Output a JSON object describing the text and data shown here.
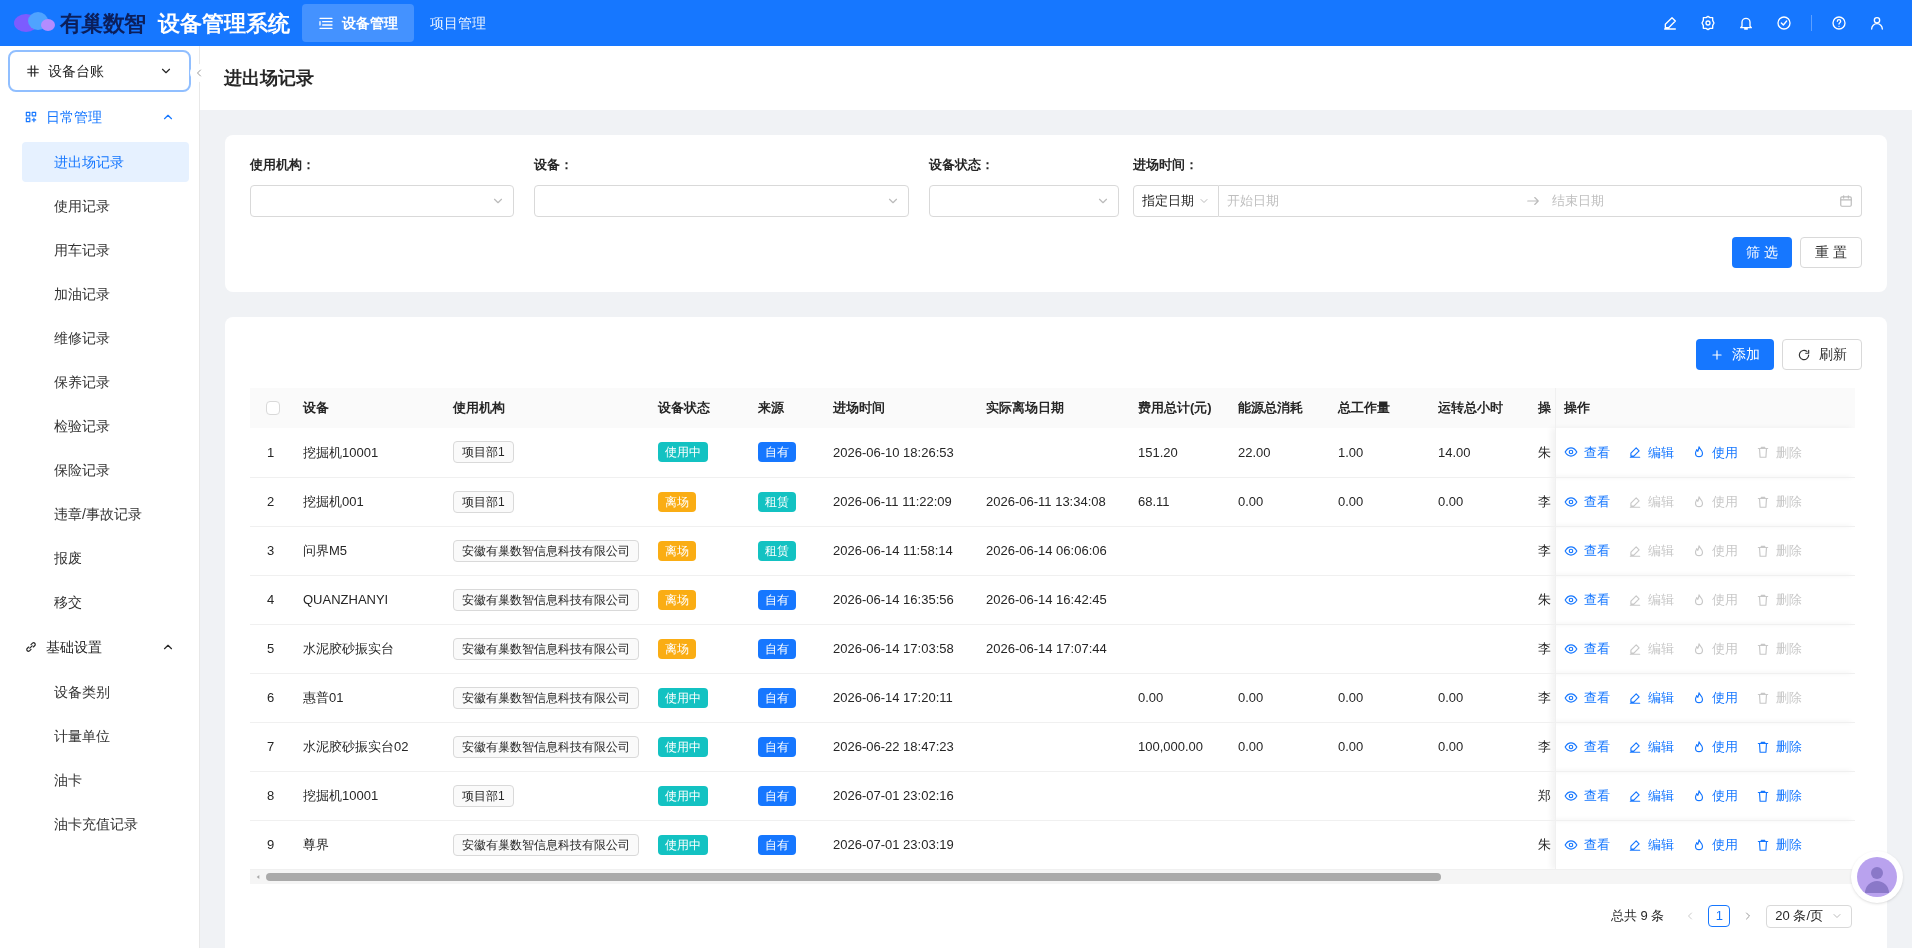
{
  "header": {
    "logo_text": "有巢数智",
    "app_title": "设备管理系统",
    "nav_tabs": [
      {
        "label": "设备管理",
        "selected": true
      },
      {
        "label": "项目管理",
        "selected": false
      }
    ]
  },
  "sidebar": {
    "items": [
      {
        "label": "设备台账",
        "kind": "ledger",
        "expanded": false,
        "focused": true
      },
      {
        "label": "日常管理",
        "kind": "daily",
        "expanded": true,
        "focused": false,
        "children": [
          {
            "label": "进出场记录",
            "selected": true
          },
          {
            "label": "使用记录",
            "selected": false
          },
          {
            "label": "用车记录",
            "selected": false
          },
          {
            "label": "加油记录",
            "selected": false
          },
          {
            "label": "维修记录",
            "selected": false
          },
          {
            "label": "保养记录",
            "selected": false
          },
          {
            "label": "检验记录",
            "selected": false
          },
          {
            "label": "保险记录",
            "selected": false
          },
          {
            "label": "违章/事故记录",
            "selected": false
          },
          {
            "label": "报废",
            "selected": false
          },
          {
            "label": "移交",
            "selected": false
          }
        ]
      },
      {
        "label": "基础设置",
        "kind": "settings",
        "expanded": true,
        "focused": false,
        "children": [
          {
            "label": "设备类别",
            "selected": false
          },
          {
            "label": "计量单位",
            "selected": false
          },
          {
            "label": "油卡",
            "selected": false
          },
          {
            "label": "油卡充值记录",
            "selected": false
          }
        ]
      }
    ]
  },
  "page_title": "进出场记录",
  "filters": {
    "fields": [
      {
        "label": "使用机构：",
        "kind": "select"
      },
      {
        "label": "设备：",
        "kind": "select"
      },
      {
        "label": "设备状态：",
        "kind": "select"
      },
      {
        "label": "进场时间：",
        "kind": "daterange",
        "mode": "指定日期",
        "start_placeholder": "开始日期",
        "end_placeholder": "结束日期"
      }
    ],
    "buttons": [
      {
        "label": "筛 选",
        "primary": true
      },
      {
        "label": "重 置",
        "primary": false
      }
    ]
  },
  "toolbar": [
    {
      "label": "添加",
      "kind": "add",
      "primary": true
    },
    {
      "label": "刷新",
      "kind": "refresh",
      "primary": false
    }
  ],
  "table": {
    "select_all_checked": false,
    "columns": [
      "设备",
      "使用机构",
      "设备状态",
      "来源",
      "进场时间",
      "实际离场日期",
      "费用总计(元)",
      "能源总消耗",
      "总工作量",
      "运转总小时",
      "操",
      "操作"
    ],
    "rows": [
      {
        "index": "1",
        "device": "挖掘机10001",
        "org": "项目部1",
        "status": {
          "text": "使用中",
          "color": "#13c2c2"
        },
        "source": {
          "text": "自有",
          "color": "#1677ff"
        },
        "entry_time": "2026-06-10 18:26:53",
        "exit_time": "",
        "cost": "151.20",
        "energy": "22.00",
        "workload": "1.00",
        "hours": "14.00",
        "operator": "朱",
        "actions": [
          {
            "label": "查看",
            "kind": "view",
            "enabled": true
          },
          {
            "label": "编辑",
            "kind": "edit",
            "enabled": true
          },
          {
            "label": "使用",
            "kind": "use",
            "enabled": true
          },
          {
            "label": "删除",
            "kind": "delete",
            "enabled": false
          }
        ]
      },
      {
        "index": "2",
        "device": "挖掘机001",
        "org": "项目部1",
        "status": {
          "text": "离场",
          "color": "#faad14"
        },
        "source": {
          "text": "租赁",
          "color": "#13c2c2"
        },
        "entry_time": "2026-06-11 11:22:09",
        "exit_time": "2026-06-11 13:34:08",
        "cost": "68.11",
        "energy": "0.00",
        "workload": "0.00",
        "hours": "0.00",
        "operator": "李",
        "actions": [
          {
            "label": "查看",
            "kind": "view",
            "enabled": true
          },
          {
            "label": "编辑",
            "kind": "edit",
            "enabled": false
          },
          {
            "label": "使用",
            "kind": "use",
            "enabled": false
          },
          {
            "label": "删除",
            "kind": "delete",
            "enabled": false
          }
        ]
      },
      {
        "index": "3",
        "device": "问界M5",
        "org": "安徽有巢数智信息科技有限公司",
        "status": {
          "text": "离场",
          "color": "#faad14"
        },
        "source": {
          "text": "租赁",
          "color": "#13c2c2"
        },
        "entry_time": "2026-06-14 11:58:14",
        "exit_time": "2026-06-14 06:06:06",
        "cost": "",
        "energy": "",
        "workload": "",
        "hours": "",
        "operator": "李",
        "actions": [
          {
            "label": "查看",
            "kind": "view",
            "enabled": true
          },
          {
            "label": "编辑",
            "kind": "edit",
            "enabled": false
          },
          {
            "label": "使用",
            "kind": "use",
            "enabled": false
          },
          {
            "label": "删除",
            "kind": "delete",
            "enabled": false
          }
        ]
      },
      {
        "index": "4",
        "device": "QUANZHANYI",
        "org": "安徽有巢数智信息科技有限公司",
        "status": {
          "text": "离场",
          "color": "#faad14"
        },
        "source": {
          "text": "自有",
          "color": "#1677ff"
        },
        "entry_time": "2026-06-14 16:35:56",
        "exit_time": "2026-06-14 16:42:45",
        "cost": "",
        "energy": "",
        "workload": "",
        "hours": "",
        "operator": "朱",
        "actions": [
          {
            "label": "查看",
            "kind": "view",
            "enabled": true
          },
          {
            "label": "编辑",
            "kind": "edit",
            "enabled": false
          },
          {
            "label": "使用",
            "kind": "use",
            "enabled": false
          },
          {
            "label": "删除",
            "kind": "delete",
            "enabled": false
          }
        ]
      },
      {
        "index": "5",
        "device": "水泥胶砂振实台",
        "org": "安徽有巢数智信息科技有限公司",
        "status": {
          "text": "离场",
          "color": "#faad14"
        },
        "source": {
          "text": "自有",
          "color": "#1677ff"
        },
        "entry_time": "2026-06-14 17:03:58",
        "exit_time": "2026-06-14 17:07:44",
        "cost": "",
        "energy": "",
        "workload": "",
        "hours": "",
        "operator": "李",
        "actions": [
          {
            "label": "查看",
            "kind": "view",
            "enabled": true
          },
          {
            "label": "编辑",
            "kind": "edit",
            "enabled": false
          },
          {
            "label": "使用",
            "kind": "use",
            "enabled": false
          },
          {
            "label": "删除",
            "kind": "delete",
            "enabled": false
          }
        ]
      },
      {
        "index": "6",
        "device": "惠普01",
        "org": "安徽有巢数智信息科技有限公司",
        "status": {
          "text": "使用中",
          "color": "#13c2c2"
        },
        "source": {
          "text": "自有",
          "color": "#1677ff"
        },
        "entry_time": "2026-06-14 17:20:11",
        "exit_time": "",
        "cost": "0.00",
        "energy": "0.00",
        "workload": "0.00",
        "hours": "0.00",
        "operator": "李",
        "actions": [
          {
            "label": "查看",
            "kind": "view",
            "enabled": true
          },
          {
            "label": "编辑",
            "kind": "edit",
            "enabled": true
          },
          {
            "label": "使用",
            "kind": "use",
            "enabled": true
          },
          {
            "label": "删除",
            "kind": "delete",
            "enabled": false
          }
        ]
      },
      {
        "index": "7",
        "device": "水泥胶砂振实台02",
        "org": "安徽有巢数智信息科技有限公司",
        "status": {
          "text": "使用中",
          "color": "#13c2c2"
        },
        "source": {
          "text": "自有",
          "color": "#1677ff"
        },
        "entry_time": "2026-06-22 18:47:23",
        "exit_time": "",
        "cost": "100,000.00",
        "energy": "0.00",
        "workload": "0.00",
        "hours": "0.00",
        "operator": "李",
        "actions": [
          {
            "label": "查看",
            "kind": "view",
            "enabled": true
          },
          {
            "label": "编辑",
            "kind": "edit",
            "enabled": true
          },
          {
            "label": "使用",
            "kind": "use",
            "enabled": true
          },
          {
            "label": "删除",
            "kind": "delete",
            "enabled": true
          }
        ]
      },
      {
        "index": "8",
        "device": "挖掘机10001",
        "org": "项目部1",
        "status": {
          "text": "使用中",
          "color": "#13c2c2"
        },
        "source": {
          "text": "自有",
          "color": "#1677ff"
        },
        "entry_time": "2026-07-01 23:02:16",
        "exit_time": "",
        "cost": "",
        "energy": "",
        "workload": "",
        "hours": "",
        "operator": "郑",
        "actions": [
          {
            "label": "查看",
            "kind": "view",
            "enabled": true
          },
          {
            "label": "编辑",
            "kind": "edit",
            "enabled": true
          },
          {
            "label": "使用",
            "kind": "use",
            "enabled": true
          },
          {
            "label": "删除",
            "kind": "delete",
            "enabled": true
          }
        ]
      },
      {
        "index": "9",
        "device": "尊界",
        "org": "安徽有巢数智信息科技有限公司",
        "status": {
          "text": "使用中",
          "color": "#13c2c2"
        },
        "source": {
          "text": "自有",
          "color": "#1677ff"
        },
        "entry_time": "2026-07-01 23:03:19",
        "exit_time": "",
        "cost": "",
        "energy": "",
        "workload": "",
        "hours": "",
        "operator": "朱",
        "actions": [
          {
            "label": "查看",
            "kind": "view",
            "enabled": true
          },
          {
            "label": "编辑",
            "kind": "edit",
            "enabled": true
          },
          {
            "label": "使用",
            "kind": "use",
            "enabled": true
          },
          {
            "label": "删除",
            "kind": "delete",
            "enabled": true
          }
        ]
      }
    ]
  },
  "pagination": {
    "total": "总共 9 条",
    "pages": [
      {
        "label": "1",
        "selected": true
      }
    ],
    "page_size": "20 条/页"
  }
}
